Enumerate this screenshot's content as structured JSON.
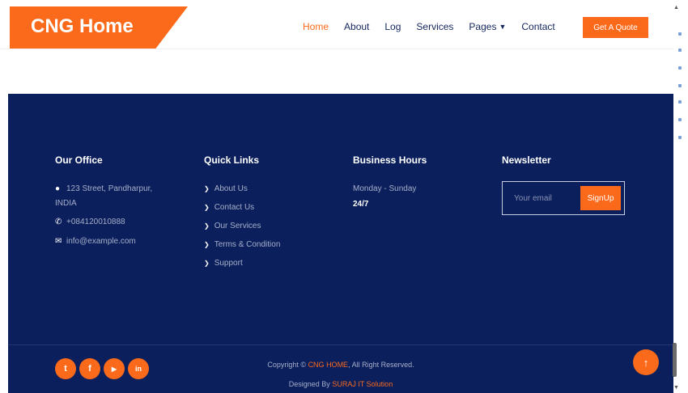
{
  "brand": {
    "name": "CNG Home"
  },
  "nav": {
    "items": [
      "Home",
      "About",
      "Log",
      "Services",
      "Pages",
      "Contact"
    ],
    "active": "Home",
    "quote_button": "Get A Quote"
  },
  "footer": {
    "office": {
      "title": "Our Office",
      "address_line1": "123 Street, Pandharpur,",
      "address_line2": "INDIA",
      "phone": "+084120010888",
      "email": "info@example.com",
      "social": [
        {
          "icon": "twitter-icon",
          "glyph": "t"
        },
        {
          "icon": "facebook-icon",
          "glyph": "f"
        },
        {
          "icon": "youtube-icon",
          "glyph": "▶"
        },
        {
          "icon": "linkedin-icon",
          "glyph": "in"
        }
      ]
    },
    "quick_links": {
      "title": "Quick Links",
      "items": [
        "About Us",
        "Contact Us",
        "Our Services",
        "Terms & Condition",
        "Support"
      ]
    },
    "hours": {
      "title": "Business Hours",
      "days": "Monday - Sunday",
      "value": "24/7"
    },
    "newsletter": {
      "title": "Newsletter",
      "placeholder": "Your email",
      "button": "SignUp"
    },
    "copyright": {
      "prefix": "Copyright ©",
      "brand": "CNG HOME",
      "suffix": ", All Right Reserved."
    },
    "designed": {
      "prefix": "Designed By",
      "by": "SURAJ IT Solution"
    }
  },
  "colors": {
    "accent": "#fb6a1b",
    "footer_bg": "#0b1f5c",
    "nav_text": "#15265e"
  }
}
